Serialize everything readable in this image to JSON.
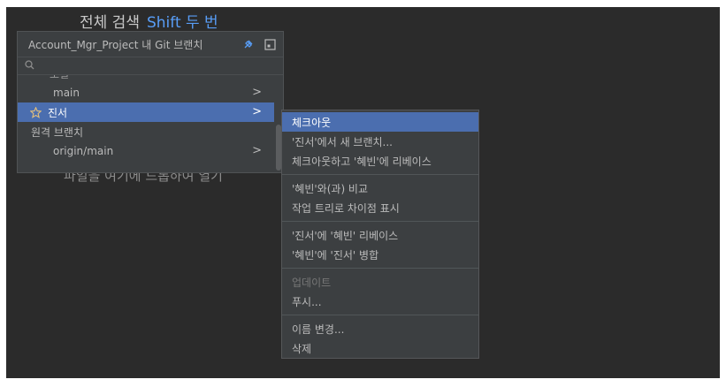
{
  "search_hint": {
    "label": "전체 검색",
    "shortcut": "Shift 두 번"
  },
  "background_hint": "파일을 여기에 드롭하여 열기",
  "branch_popup": {
    "title": "Account_Mgr_Project 내 Git 브랜치",
    "search_placeholder": "",
    "partial_header": "로컬",
    "rows": [
      {
        "label": "main",
        "chevron": ">"
      },
      {
        "label": "진서",
        "chevron": ">",
        "starred": true,
        "selected": true
      },
      {
        "label": "원격 브랜치"
      },
      {
        "label": "origin/main",
        "chevron": ">"
      }
    ]
  },
  "context_menu": {
    "groups": [
      [
        "체크아웃",
        "'진서'에서 새 브랜치...",
        "체크아웃하고 '혜빈'에 리베이스"
      ],
      [
        "'혜빈'와(과) 비교",
        "작업 트리로 차이점 표시"
      ],
      [
        "'진서'에 '혜빈' 리베이스",
        "'혜빈'에 '진서' 병합"
      ],
      [
        "업데이트",
        "푸시..."
      ],
      [
        "이름 변경...",
        "삭제"
      ]
    ],
    "selected_item": "체크아웃",
    "disabled_item": "업데이트"
  },
  "colors": {
    "background": "#2b2b2b",
    "popup": "#3c3f41",
    "selection": "#4b6eaf",
    "link": "#589df6",
    "star": "#e5c07b"
  }
}
